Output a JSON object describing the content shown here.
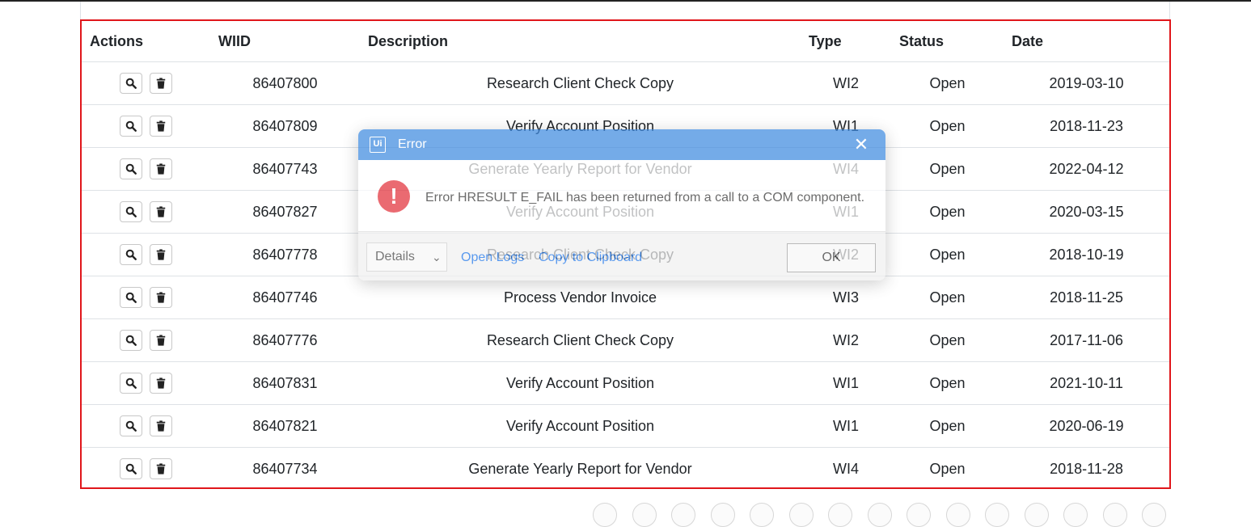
{
  "table": {
    "headers": {
      "actions": "Actions",
      "wiid": "WIID",
      "description": "Description",
      "type": "Type",
      "status": "Status",
      "date": "Date"
    },
    "rows": [
      {
        "wiid": "86407800",
        "description": "Research Client Check Copy",
        "type": "WI2",
        "status": "Open",
        "date": "2019-03-10"
      },
      {
        "wiid": "86407809",
        "description": "Verify Account Position",
        "type": "WI1",
        "status": "Open",
        "date": "2018-11-23"
      },
      {
        "wiid": "86407743",
        "description": "Generate Yearly Report for Vendor",
        "type": "WI4",
        "status": "Open",
        "date": "2022-04-12"
      },
      {
        "wiid": "86407827",
        "description": "Verify Account Position",
        "type": "WI1",
        "status": "Open",
        "date": "2020-03-15"
      },
      {
        "wiid": "86407778",
        "description": "Research Client Check Copy",
        "type": "WI2",
        "status": "Open",
        "date": "2018-10-19"
      },
      {
        "wiid": "86407746",
        "description": "Process Vendor Invoice",
        "type": "WI3",
        "status": "Open",
        "date": "2018-11-25"
      },
      {
        "wiid": "86407776",
        "description": "Research Client Check Copy",
        "type": "WI2",
        "status": "Open",
        "date": "2017-11-06"
      },
      {
        "wiid": "86407831",
        "description": "Verify Account Position",
        "type": "WI1",
        "status": "Open",
        "date": "2021-10-11"
      },
      {
        "wiid": "86407821",
        "description": "Verify Account Position",
        "type": "WI1",
        "status": "Open",
        "date": "2020-06-19"
      },
      {
        "wiid": "86407734",
        "description": "Generate Yearly Report for Vendor",
        "type": "WI4",
        "status": "Open",
        "date": "2018-11-28"
      }
    ],
    "action_icons": [
      "search-icon",
      "trash-icon"
    ]
  },
  "dialog": {
    "logo": "Ui",
    "title": "Error",
    "message": "Error HRESULT E_FAIL has been returned from a call to a COM component.",
    "details_label": "Details",
    "open_logs_label": "Open Logs",
    "copy_label": "Copy to Clipboard",
    "ok_label": "OK",
    "icons": [
      "close-icon",
      "error-icon",
      "chevron-down-icon"
    ]
  },
  "colors": {
    "table_border": "#e0161b",
    "dialog_titlebar": "#3f8be0",
    "error_icon": "#e3323b",
    "link": "#1a73e8"
  }
}
